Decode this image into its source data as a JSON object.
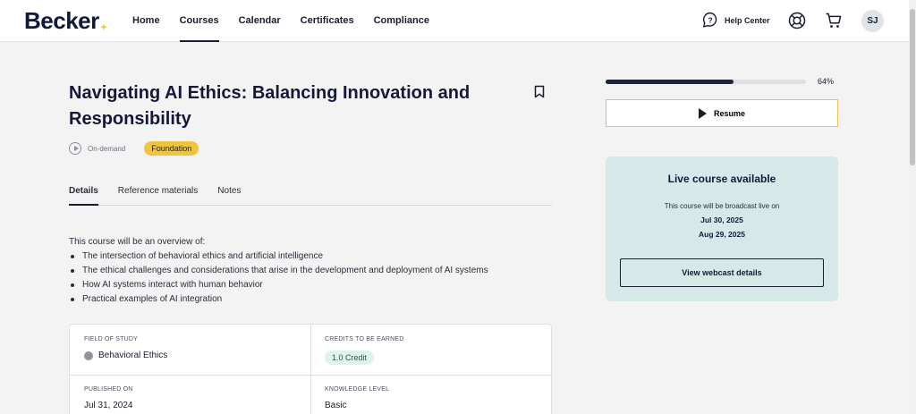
{
  "header": {
    "logo": "Becker",
    "logo_mark": "+",
    "nav": [
      {
        "label": "Home",
        "active": false
      },
      {
        "label": "Courses",
        "active": true
      },
      {
        "label": "Calendar",
        "active": false
      },
      {
        "label": "Certificates",
        "active": false
      },
      {
        "label": "Compliance",
        "active": false
      }
    ],
    "help_label": "Help Center",
    "avatar_initials": "SJ"
  },
  "course": {
    "title": "Navigating AI Ethics: Balancing Innovation and Responsibility",
    "format": "On-demand",
    "level_badge": "Foundation",
    "tabs": [
      {
        "label": "Details",
        "active": true
      },
      {
        "label": "Reference materials",
        "active": false
      },
      {
        "label": "Notes",
        "active": false
      }
    ],
    "intro": "This course will be an overview of:",
    "bullets": [
      "The intersection of behavioral ethics and artificial intelligence",
      "The ethical challenges and considerations that arise in the development and deployment of AI systems",
      "How AI systems interact with human behavior",
      "Practical examples of AI integration"
    ],
    "info": {
      "field_of_study_label": "FIELD OF STUDY",
      "field_of_study": "Behavioral Ethics",
      "credits_label": "CREDITS TO BE EARNED",
      "credits": "1.0 Credit",
      "published_label": "PUBLISHED ON",
      "published": "Jul 31, 2024",
      "knowledge_label": "KNOWLEDGE LEVEL",
      "knowledge": "Basic"
    }
  },
  "progress": {
    "fraction": 0.64,
    "label": "64%",
    "resume_label": "Resume"
  },
  "live": {
    "title": "Live course available",
    "text": "This course will be broadcast live on",
    "dates": [
      "Jul 30, 2025",
      "Aug 29, 2025"
    ],
    "button": "View webcast details"
  },
  "colors": {
    "accent_yellow": "#f2c33d",
    "navy": "#1a2540",
    "live_bg": "#d5e9e8",
    "credit_bg": "#dff3ea"
  }
}
